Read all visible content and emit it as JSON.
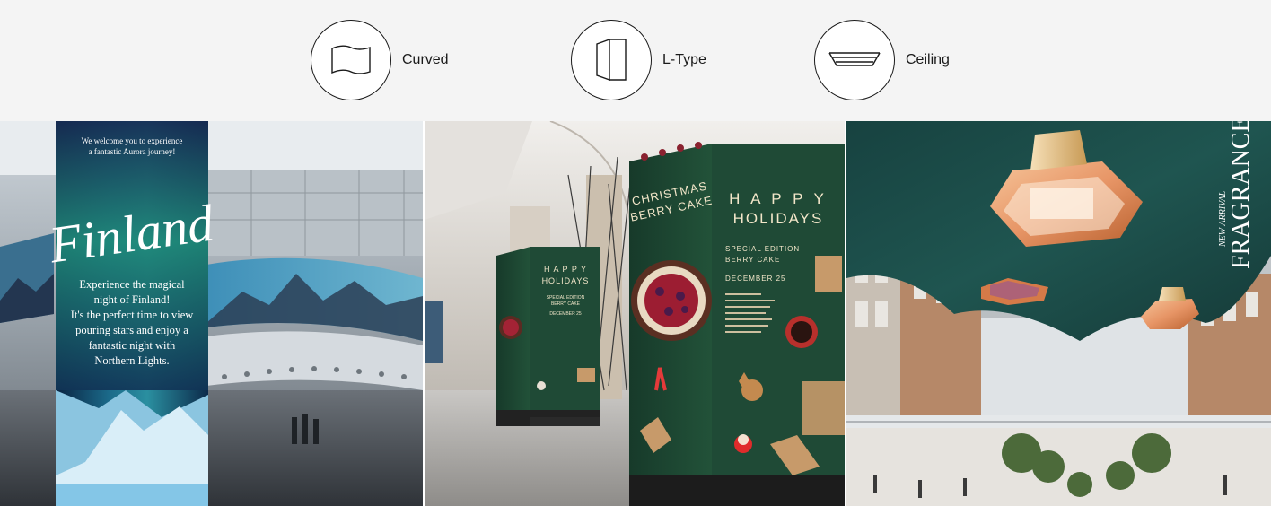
{
  "tabs": [
    {
      "id": "curved",
      "label": "Curved",
      "icon": "curved-display-icon"
    },
    {
      "id": "ltype",
      "label": "L-Type",
      "icon": "l-type-display-icon"
    },
    {
      "id": "ceiling",
      "label": "Ceiling",
      "icon": "ceiling-display-icon"
    }
  ],
  "panels": {
    "curved": {
      "banner_line1": "We welcome you to experience",
      "banner_line2": "a fantastic Aurora journey!",
      "headline": "Finland",
      "body_lines": [
        "Experience the magical",
        "night of Finland!",
        "It's the perfect time to view",
        "pouring stars and enjoy a",
        "fantastic night with",
        "Northern Lights."
      ]
    },
    "ltype": {
      "left_title_1": "CHRISTMAS",
      "left_title_2": "BERRY CAKE",
      "right_title_1": "H A P P Y",
      "right_title_2": "HOLIDAYS",
      "edition_1": "SPECIAL EDITION",
      "edition_2": "BERRY CAKE",
      "date": "DECEMBER 25",
      "small_title_1": "H A P P Y",
      "small_title_2": "HOLIDAYS",
      "small_edition_1": "SPECIAL EDITION",
      "small_edition_2": "BERRY CAKE",
      "small_date": "DECEMBER 25"
    },
    "ceiling": {
      "new_arrival": "NEW ARRIVAL",
      "fragrance": "FRAGRANCE"
    }
  },
  "colors": {
    "tab_bar_bg": "#f4f4f4",
    "icon_stroke": "#1a1a1a",
    "poster_green": "#1f4a36",
    "ceiling_teal": "#1e4a46"
  }
}
